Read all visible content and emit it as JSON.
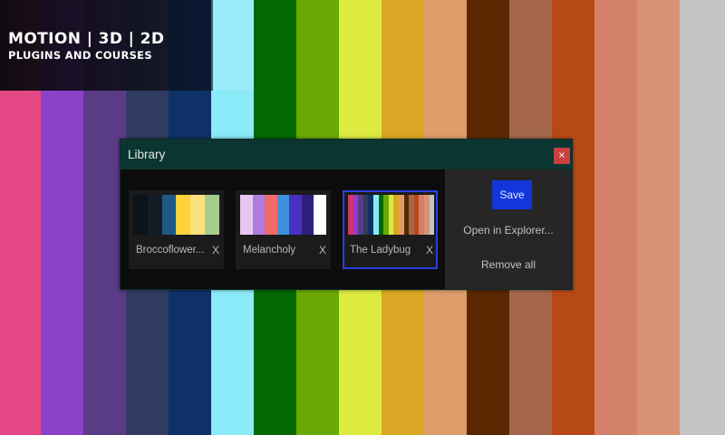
{
  "background": {
    "stripes": [
      {
        "color": "#e34784"
      },
      {
        "color": "#8a42c9"
      },
      {
        "color": "#5a3b86"
      },
      {
        "color": "#2f3b60"
      },
      {
        "color": "#0e3167"
      },
      {
        "color": "#8beaf7"
      },
      {
        "color": "#056800"
      },
      {
        "color": "#6aa903"
      },
      {
        "color": "#ddea40"
      },
      {
        "color": "#dca625"
      },
      {
        "color": "#dc9d6b"
      },
      {
        "color": "#5a2700"
      },
      {
        "color": "#a4674c"
      },
      {
        "color": "#b74917"
      },
      {
        "color": "#d2806a"
      },
      {
        "color": "#d99276"
      },
      {
        "color": "#c4c4c4"
      }
    ]
  },
  "brand": {
    "line1": "MOTION | 3D | 2D",
    "line2": "PLUGINS AND COURSES"
  },
  "dialog": {
    "title": "Library",
    "close_label": "×",
    "cards": [
      {
        "name": "Broccoflower...",
        "remove_label": "X",
        "selected": false,
        "colors": [
          "#0b1219",
          "#121c26",
          "#1d5a84",
          "#ffd23c",
          "#f9e27e",
          "#a5cc8e"
        ]
      },
      {
        "name": "Melancholy",
        "remove_label": "X",
        "selected": false,
        "colors": [
          "#e9c7f2",
          "#b07ce0",
          "#f06a6a",
          "#3f8fe0",
          "#4b2fbf",
          "#2a1f7a",
          "#ffffff"
        ]
      },
      {
        "name": "The Ladybug",
        "remove_label": "X",
        "selected": true,
        "colors": [
          "#d5326e",
          "#8a3fcb",
          "#5a3b86",
          "#2f3b60",
          "#0e3167",
          "#8beaf7",
          "#056800",
          "#6aa903",
          "#ddea40",
          "#dca625",
          "#dc9d6b",
          "#5a2700",
          "#a4674c",
          "#b74917",
          "#d2806a",
          "#d99276",
          "#c4c4c4"
        ]
      }
    ],
    "actions": {
      "save": "Save",
      "open_explorer": "Open in Explorer...",
      "remove_all": "Remove all"
    }
  }
}
